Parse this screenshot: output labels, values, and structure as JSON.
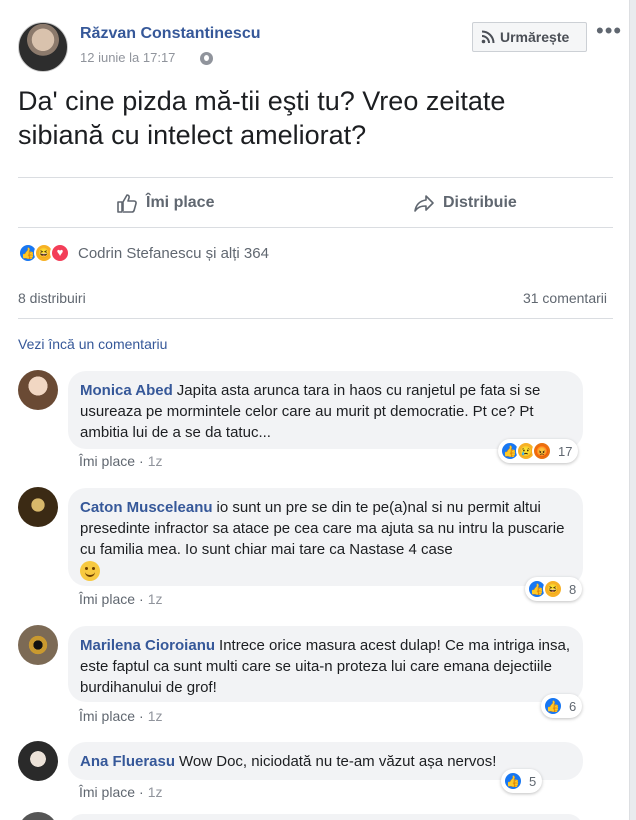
{
  "post": {
    "author": "Răzvan Constantinescu",
    "timestamp": "12 iunie la 17:17",
    "follow_label": "Urmărește",
    "text": "Da' cine pizda mă-tii eşti tu? Vreo zeitate sibiană cu intelect ameliorat?",
    "like_label": "Îmi place",
    "share_label": "Distribuie",
    "reactions_summary": "Codrin Stefanescu și alți 364",
    "shares_count": "8 distribuiri",
    "comments_count": "31 comentarii",
    "view_more": "Vezi încă un comentariu"
  },
  "comments": [
    {
      "author": "Monica Abed",
      "text": "Japita asta arunca tara in haos cu ranjetul pe fata si se usureaza pe mormintele celor care au murit pt democratie. Pt ce? Pt ambitia lui de a se da tatuc...",
      "like_label": "Îmi place",
      "age": "1z",
      "reaction_count": "17"
    },
    {
      "author": "Caton Musceleanu",
      "text": "io sunt un pre se din te pe(a)nal si nu permit altui presedinte infractor sa atace pe cea care ma ajuta sa nu intru la puscarie cu familia mea. Io sunt chiar mai tare ca Nastase 4 case",
      "like_label": "Îmi place",
      "age": "1z",
      "reaction_count": "8"
    },
    {
      "author": "Marilena Cioroianu",
      "text": "Intrece orice masura acest dulap! Ce ma intriga insa, este faptul ca sunt multi care se uita-n proteza lui care emana dejectiile burdihanului de grof!",
      "like_label": "Îmi place",
      "age": "1z",
      "reaction_count": "6"
    },
    {
      "author": "Ana Fluerasu",
      "text": "Wow Doc, niciodată nu te-am văzut așa nervos!",
      "like_label": "Îmi place",
      "age": "1z",
      "reaction_count": "5"
    }
  ],
  "colors": {
    "link": "#365899",
    "like": "#1877f2",
    "muted": "#606770"
  }
}
